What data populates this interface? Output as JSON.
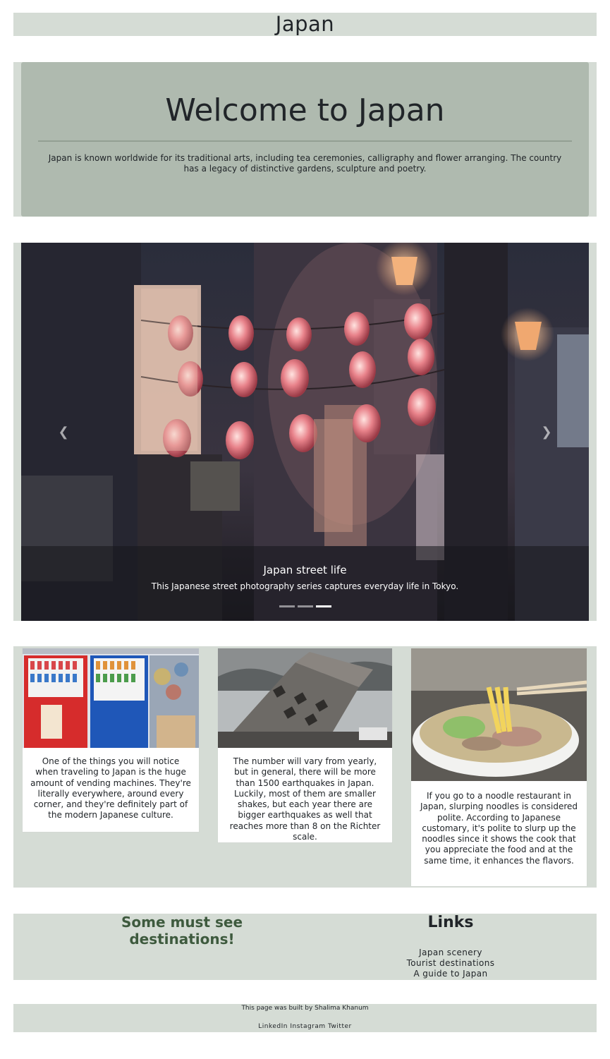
{
  "header": {
    "title": "Japan"
  },
  "hero": {
    "heading": "Welcome to Japan",
    "text": "Japan is known worldwide for its traditional arts, including tea ceremonies, calligraphy and flower arranging. The country has a legacy of distinctive gardens, sculpture and poetry."
  },
  "carousel": {
    "caption_title": "Japan street life",
    "caption_text": "This Japanese street photography series captures everyday life in Tokyo.",
    "prev_icon": "chevron-left-icon",
    "next_icon": "chevron-right-icon",
    "slide_count": 3,
    "active_slide": 3
  },
  "cards": [
    {
      "image": "vending-machines-photo",
      "text": "One of the things you will notice when traveling to Japan is the huge amount of vending machines. They're literally everywhere, around every corner, and they're definitely part of the modern Japanese culture."
    },
    {
      "image": "collapsed-building-photo",
      "text": "The number will vary from yearly, but in general, there will be more than 1500 earthquakes in Japan. Luckily, most of them are smaller shakes, but each year there are bigger earthquakes as well that reaches more than 8 on the Richter scale."
    },
    {
      "image": "ramen-bowl-photo",
      "text": "If you go to a noodle restaurant in Japan, slurping noodles is considered polite. According to Japanese customary, it's polite to slurp up the noodles since it shows the cook that you appreciate the food and at the same time, it enhances the flavors."
    }
  ],
  "destinations": {
    "title": "Some must see destinations!"
  },
  "links": {
    "title": "Links",
    "items": [
      "Japan scenery",
      "Tourist destinations",
      "A guide to Japan"
    ]
  },
  "footer": {
    "credit": "This page was built by Shalima Khanum",
    "social": [
      "LinkedIn",
      "Instagram",
      "Twitter"
    ]
  },
  "colors": {
    "band": "#d5dcd5",
    "hero_box": "#afbaaf",
    "accent_green": "#3e5a3e"
  }
}
